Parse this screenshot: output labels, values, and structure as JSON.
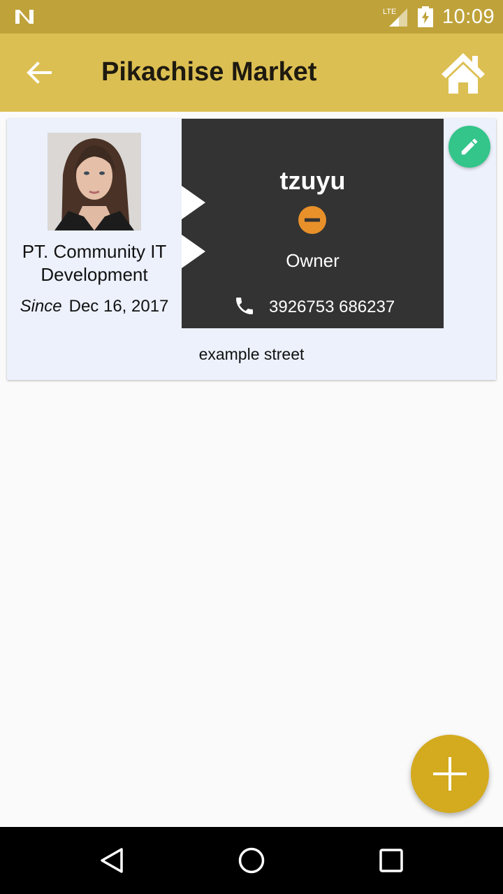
{
  "status_bar": {
    "time": "10:09",
    "network_label": "LTE",
    "icons": [
      "notification-n-icon",
      "lte-signal-icon",
      "battery-charging-icon"
    ]
  },
  "app_bar": {
    "title": "Pikachise Market",
    "back_icon": "arrow-back-icon",
    "home_icon": "home-icon"
  },
  "card": {
    "company_name": "PT. Community IT Development",
    "since_label": "Since",
    "since_date": "Dec 16, 2017",
    "owner_name": "tzuyu",
    "role": "Owner",
    "phone": "3926753 686237",
    "address": "example street",
    "status_color": "#e8902a",
    "edit_icon": "pencil-icon"
  },
  "colors": {
    "status_bar": "#bfa23a",
    "app_bar": "#dcbf52",
    "fab": "#d4aa1e",
    "edit_button": "#33c58a",
    "dark_panel": "#333333",
    "card_bg": "#ecf1fc"
  },
  "fab": {
    "icon": "plus-icon"
  },
  "nav_bar": {
    "icons": [
      "nav-back-icon",
      "nav-home-icon",
      "nav-recents-icon"
    ]
  }
}
